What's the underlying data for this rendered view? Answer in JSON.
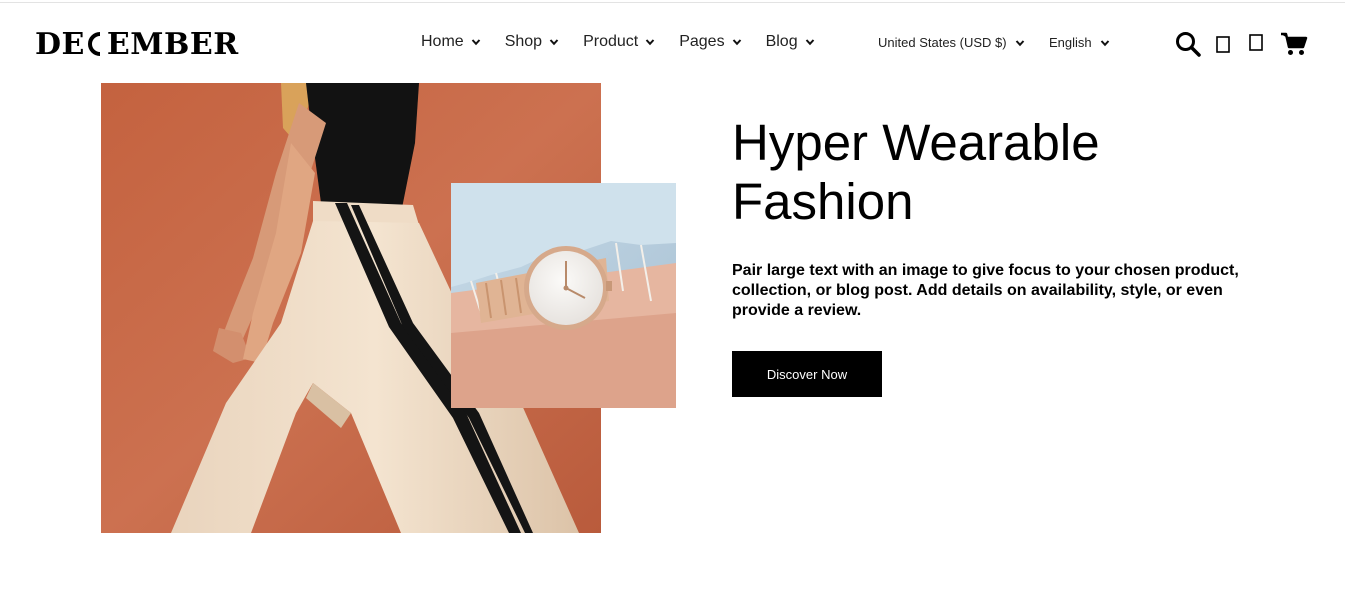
{
  "brand": {
    "logo_text_left": "DE",
    "logo_text_right": "EMBER"
  },
  "nav": {
    "items": [
      {
        "label": "Home",
        "icon": "chevron-down-icon"
      },
      {
        "label": "Shop",
        "icon": "chevron-down-icon"
      },
      {
        "label": "Product",
        "icon": "chevron-down-icon"
      },
      {
        "label": "Pages",
        "icon": "chevron-down-icon"
      },
      {
        "label": "Blog",
        "icon": "chevron-down-icon"
      }
    ]
  },
  "locale": {
    "currency": "United States (USD $)",
    "language": "English"
  },
  "header_icons": [
    "search-icon",
    "account-icon",
    "wishlist-icon",
    "cart-icon"
  ],
  "hero": {
    "title_line1": "Hyper Wearable",
    "title_line2": "Fashion",
    "text": "Pair large text with an image to give focus to your chosen product, collection, or blog post. Add details on availability, style, or even provide a review.",
    "button_label": "Discover Now"
  },
  "colors": {
    "background": "#ffffff",
    "button_bg": "#000000",
    "button_text": "#ffffff",
    "image_wall": "#c86a4c"
  }
}
